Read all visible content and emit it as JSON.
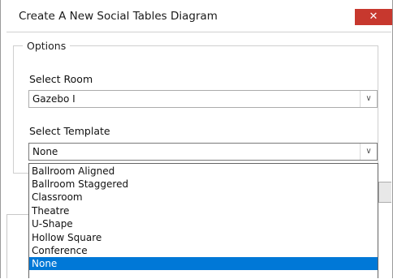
{
  "window": {
    "title": "Create A New Social Tables Diagram",
    "close_glyph": "✕"
  },
  "options": {
    "legend": "Options",
    "room": {
      "label": "Select Room",
      "value": "Gazebo I"
    },
    "template": {
      "label": "Select Template",
      "value": "None",
      "options": [
        "Ballroom Aligned",
        "Ballroom Staggered",
        "Classroom",
        "Theatre",
        "U-Shape",
        "Hollow Square",
        "Conference",
        "None"
      ],
      "selected_index": 7
    }
  },
  "icons": {
    "dropdown_arrow": "chevron-down-icon",
    "close": "close-icon"
  },
  "colors": {
    "close_button": "#c7382e",
    "selection": "#0078d7"
  }
}
